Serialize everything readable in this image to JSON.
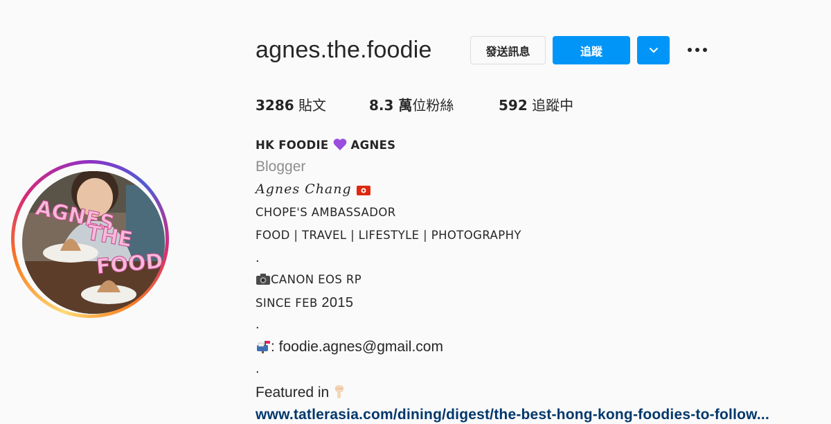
{
  "profile": {
    "username": "agnes.the.foodie",
    "message_label": "發送訊息",
    "follow_label": "追蹤",
    "avatar_text": [
      "AGNES",
      "THE",
      "FOODIE"
    ]
  },
  "stats": {
    "posts_count": "3286",
    "posts_label": "貼文",
    "followers_count": "8.3 萬",
    "followers_label": "位粉絲",
    "following_count": "592",
    "following_label": "追蹤中"
  },
  "bio": {
    "full_name_left": "HK FOODIE ",
    "full_name_right": " AGNES",
    "category": "Blogger",
    "script_name": "Agnes Chang",
    "ambassador": "CHOPE'S AMBASSADOR",
    "categories": "FOOD | TRAVEL | LIFESTYLE | PHOTOGRAPHY",
    "dot1": ".",
    "camera": "CANON EOS RP",
    "since_prefix": "SINCE FEB ",
    "since_year": "2015",
    "dot2": ".",
    "email": ": foodie.agnes@gmail.com",
    "dot3": ".",
    "featured": "Featured in ",
    "link": "www.tatlerasia.com/dining/digest/the-best-hong-kong-foodies-to-follow..."
  },
  "colors": {
    "follow_blue": "#0095f6",
    "link_navy": "#00376b",
    "category_gray": "#8e8e8e",
    "heart_purple": "#9b4dde",
    "avatar_text_pink": "#f5a8d0"
  },
  "icons": {
    "heart": "purple-heart-icon",
    "flag": "hong-kong-flag-icon",
    "camera": "camera-icon",
    "mailbox": "mailbox-icon",
    "pointer": "backhand-index-pointing-down-icon",
    "dropdown": "chevron-down-icon",
    "more": "more-options-icon"
  }
}
